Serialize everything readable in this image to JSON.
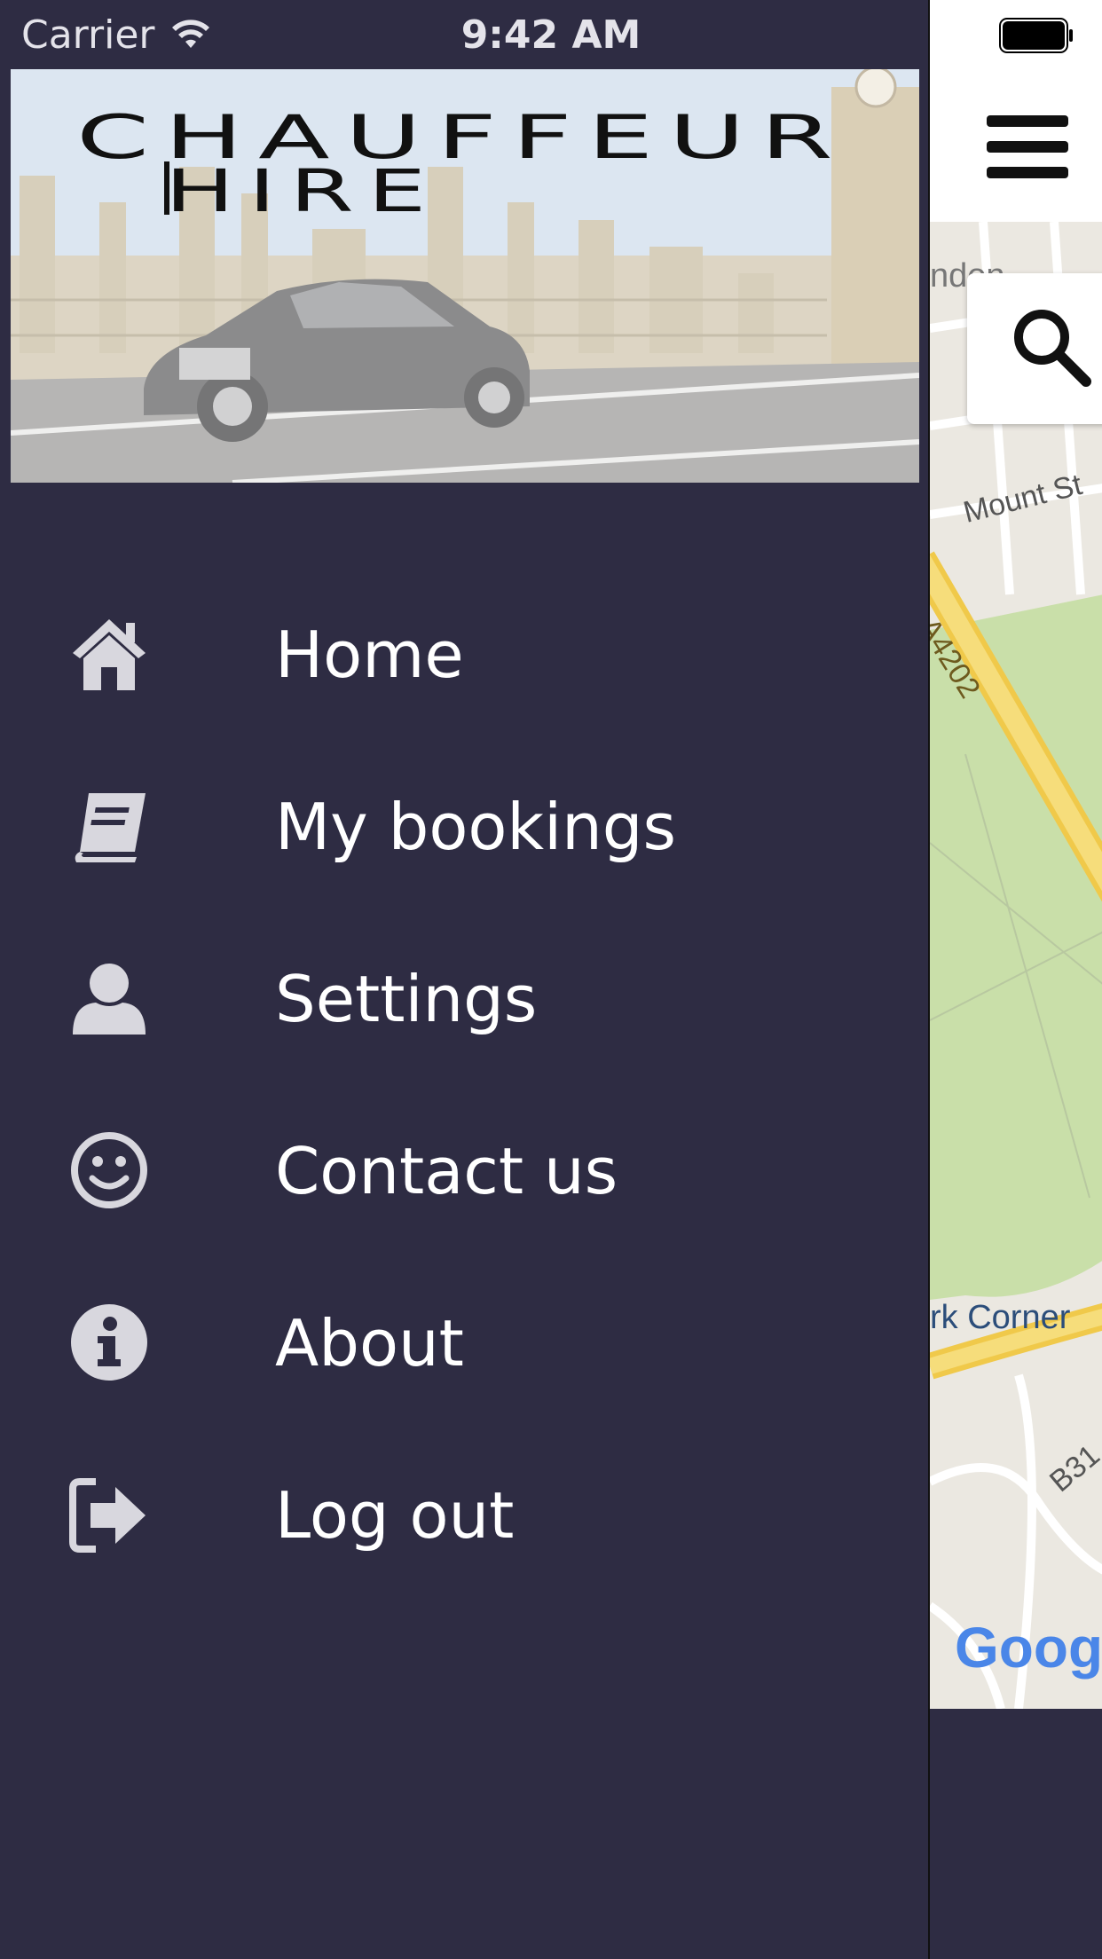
{
  "status_bar": {
    "carrier": "Carrier",
    "time": "9:42 AM"
  },
  "header": {
    "brand_line1": "CHAUFFEUR",
    "brand_line2": "HIRE"
  },
  "menu": {
    "items": [
      {
        "label": "Home",
        "icon": "home-icon"
      },
      {
        "label": "My bookings",
        "icon": "book-icon"
      },
      {
        "label": "Settings",
        "icon": "user-icon"
      },
      {
        "label": "Contact us",
        "icon": "smiley-icon"
      },
      {
        "label": "About",
        "icon": "info-icon"
      },
      {
        "label": "Log out",
        "icon": "logout-icon"
      }
    ]
  },
  "map": {
    "labels": [
      "ndon",
      "Mount St",
      "A4202",
      "rk Corner",
      "B31",
      "Googl"
    ]
  },
  "colors": {
    "drawer_bg": "#2e2c43",
    "text": "#ffffff",
    "icon": "#d8d7de"
  }
}
